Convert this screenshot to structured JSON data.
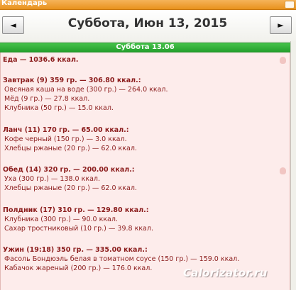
{
  "window": {
    "title": "Календарь"
  },
  "nav": {
    "prev_label": "◄",
    "next_label": "►",
    "date_title": "Суббота, Июн 13, 2015"
  },
  "day_header": "Суббота 13.06",
  "summary": "Еда — 1036.6 ккал.",
  "meals": [
    {
      "header": "Завтрак (9) 359 гр. — 306.80 ккал.:",
      "items": [
        "Овсяная каша на воде (300 гр.) — 264.0 ккал.",
        "Мёд (9 гр.) — 27.8 ккал.",
        "Клубника (50 гр.) — 15.0 ккал."
      ]
    },
    {
      "header": "Ланч (11) 170 гр. — 65.00 ккал.:",
      "items": [
        "Кофе черный (150 гр.) — 3.0 ккал.",
        "Хлебцы ржаные (20 гр.) — 62.0 ккал."
      ]
    },
    {
      "header": "Обед (14) 320 гр. — 200.00 ккал.:",
      "items": [
        "Уха (300 гр.) — 138.0 ккал.",
        "Хлебцы ржаные (20 гр.) — 62.0 ккал."
      ]
    },
    {
      "header": "Полдник (17) 310 гр. — 129.80 ккал.:",
      "items": [
        "Клубника (300 гр.) — 90.0 ккал.",
        "Сахар тростниковый (10 гр.) — 39.8 ккал."
      ]
    },
    {
      "header": "Ужин (19:18) 350 гр. — 335.00 ккал.:",
      "items": [
        "Фасоль Бондюэль белая в томатном соусе (150 гр.) — 159.0 ккал.",
        "Кабачок жареный (200 гр.) — 176.0 ккал."
      ]
    }
  ],
  "watermark": "Calorizator.ru",
  "colors": {
    "titlebar": "#e9921d",
    "day_header": "#2aa531",
    "panel_bg": "#fdeceb",
    "text": "#8b1c1c"
  },
  "icons": {
    "prev": "left-triangle",
    "next": "right-triangle",
    "hint": "hand-pointer-icon"
  }
}
